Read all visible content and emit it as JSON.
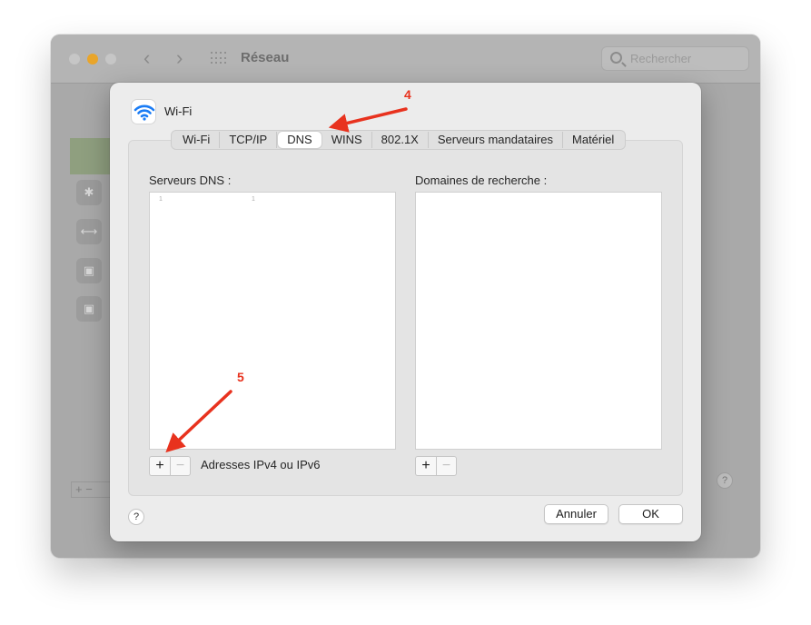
{
  "background_window": {
    "title": "Réseau",
    "search_placeholder": "Rechercher",
    "back_glyph": "‹",
    "forward_glyph": "›",
    "sidebar_icons": [
      "wifi-icon",
      "bluetooth-icon",
      "ethernet-icon",
      "lock-icon",
      "lock-icon"
    ],
    "plus_minus": "+ −",
    "help": "?"
  },
  "sheet": {
    "service_name": "Wi-Fi",
    "tabs": [
      {
        "label": "Wi-Fi",
        "active": false
      },
      {
        "label": "TCP/IP",
        "active": false
      },
      {
        "label": "DNS",
        "active": true
      },
      {
        "label": "WINS",
        "active": false
      },
      {
        "label": "802.1X",
        "active": false
      },
      {
        "label": "Serveurs mandataires",
        "active": false
      },
      {
        "label": "Matériel",
        "active": false
      }
    ],
    "dns_servers": {
      "label": "Serveurs DNS :",
      "items_visible_marks": [
        "1",
        "1"
      ],
      "hint": "Adresses IPv4 ou IPv6"
    },
    "search_domains": {
      "label": "Domaines de recherche :"
    },
    "plus": "+",
    "minus": "−",
    "help": "?",
    "cancel_label": "Annuler",
    "ok_label": "OK"
  },
  "annotations": {
    "step_4": "4",
    "step_5": "5",
    "color": "#e8321e"
  }
}
